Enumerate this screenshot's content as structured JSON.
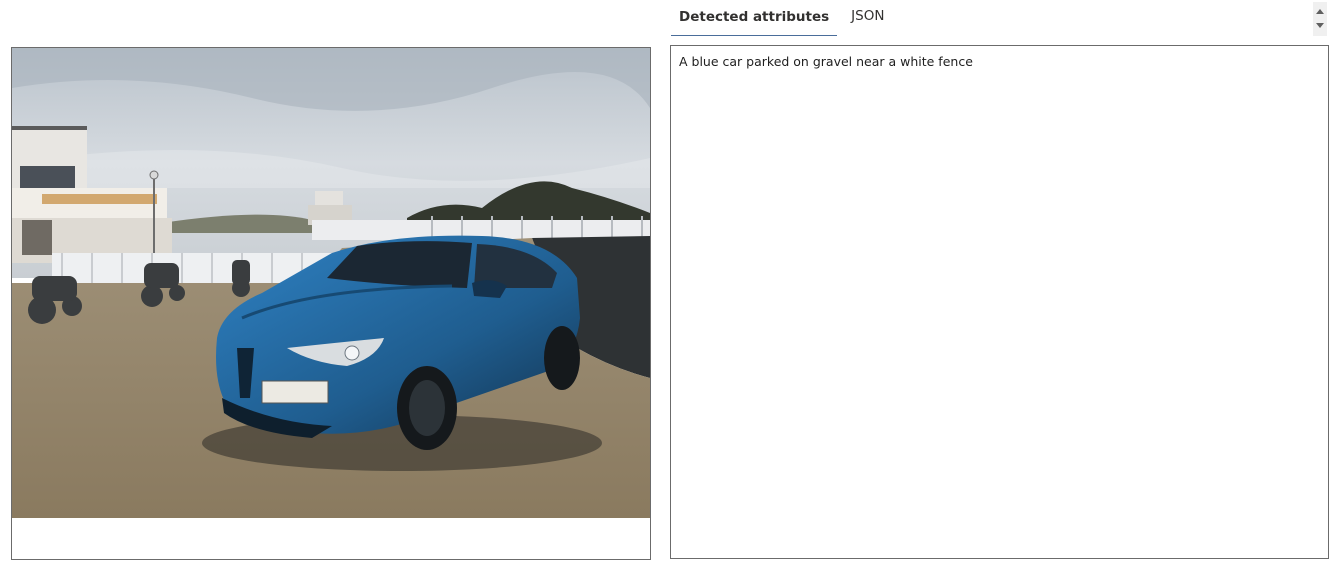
{
  "tabs": [
    {
      "label": "Detected attributes",
      "active": true
    },
    {
      "label": "JSON",
      "active": false
    }
  ],
  "image": {
    "description_icon": "car-photo",
    "scene": "blue-suv-on-gravel"
  },
  "result": {
    "caption": "A blue car parked on gravel near a white fence"
  },
  "colors": {
    "accent": "#4a6d9a",
    "car": "#2b6fa8",
    "border": "#6b6b6b"
  }
}
